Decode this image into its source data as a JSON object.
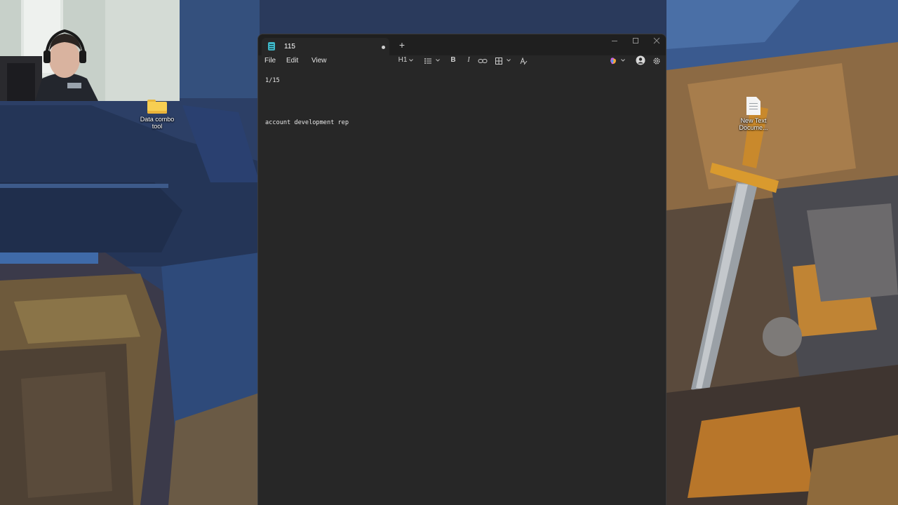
{
  "desktop": {
    "icons": [
      {
        "label": "Data combo tool",
        "icon": "folder-icon"
      },
      {
        "label": "New Text Docume...",
        "icon": "text-document-icon"
      }
    ]
  },
  "webcam": {
    "description_icon": "webcam-feed"
  },
  "window": {
    "tab_title": "115",
    "new_tab_symbol": "+",
    "menu": {
      "file": "File",
      "edit": "Edit",
      "view": "View"
    },
    "toolbar": {
      "heading": "H1",
      "bold": "B",
      "italic": "I"
    },
    "editor_lines": [
      "1/15",
      "account development rep"
    ],
    "colors": {
      "window_bg": "#272727",
      "titlebar_bg": "#1f1f1f",
      "accent": "#3fb6c6"
    }
  }
}
